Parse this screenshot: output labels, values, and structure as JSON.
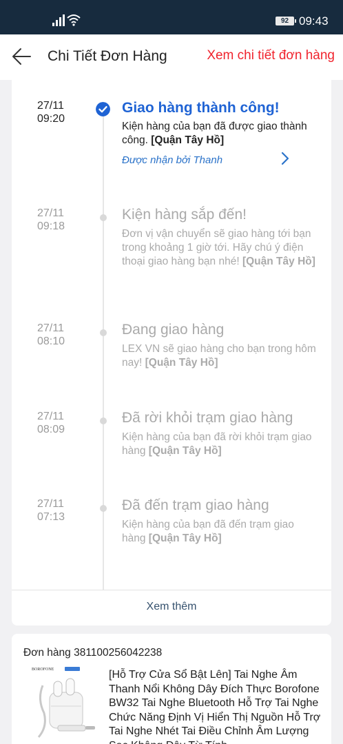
{
  "status_bar": {
    "battery": "92",
    "time": "09:43"
  },
  "header": {
    "title": "Chi Tiết Đơn Hàng",
    "details_link": "Xem chi tiết đơn hàng"
  },
  "timeline": {
    "events": [
      {
        "date": "27/11",
        "time": "09:20",
        "title": "Giao hàng thành công!",
        "desc": "Kiện hàng của bạn đã được giao thành công.",
        "location": "[Quận Tây Hồ]",
        "receiver": "Được nhận bởi Thanh",
        "status": "done"
      },
      {
        "date": "27/11",
        "time": "09:18",
        "title": "Kiện hàng sắp đến!",
        "desc": "Đơn vị vận chuyển sẽ giao hàng tới bạn trong khoảng 1 giờ tới. Hãy chú ý điện thoại giao hàng bạn nhé!",
        "location": "[Quận Tây Hồ]"
      },
      {
        "date": "27/11",
        "time": "08:10",
        "title": "Đang giao hàng",
        "desc": "LEX VN sẽ giao hàng cho bạn trong hôm nay!",
        "location": "[Quận Tây Hồ]"
      },
      {
        "date": "27/11",
        "time": "08:09",
        "title": "Đã rời khỏi trạm giao hàng",
        "desc": "Kiện hàng của bạn đã rời khỏi trạm giao hàng",
        "location": "[Quận Tây Hồ]"
      },
      {
        "date": "27/11",
        "time": "07:13",
        "title": "Đã đến trạm giao hàng",
        "desc": "Kiện hàng của bạn đã đến trạm giao hàng",
        "location": "[Quận Tây Hồ]"
      }
    ],
    "see_more": "Xem thêm"
  },
  "order": {
    "id_label": "Đơn hàng 381100256042238",
    "brand": "BOROFONE",
    "product_name": "[Hỗ Trợ Cửa Sổ Bật Lên] Tai Nghe Âm Thanh Nổi Không Dây Đích Thực Borofone BW32 Tai Nghe Bluetooth Hỗ Trợ Tai Nghe Chức Năng Định Vị Hiển Thị Nguồn Hỗ Trợ Tai Nghe Nhét Tai Điều Chỉnh Âm Lượng Sạc Không Dây Từ Tính"
  },
  "colors": {
    "accent_blue": "#1f63d4",
    "link_red": "#f0232d",
    "status_bar": "#172b3e"
  }
}
